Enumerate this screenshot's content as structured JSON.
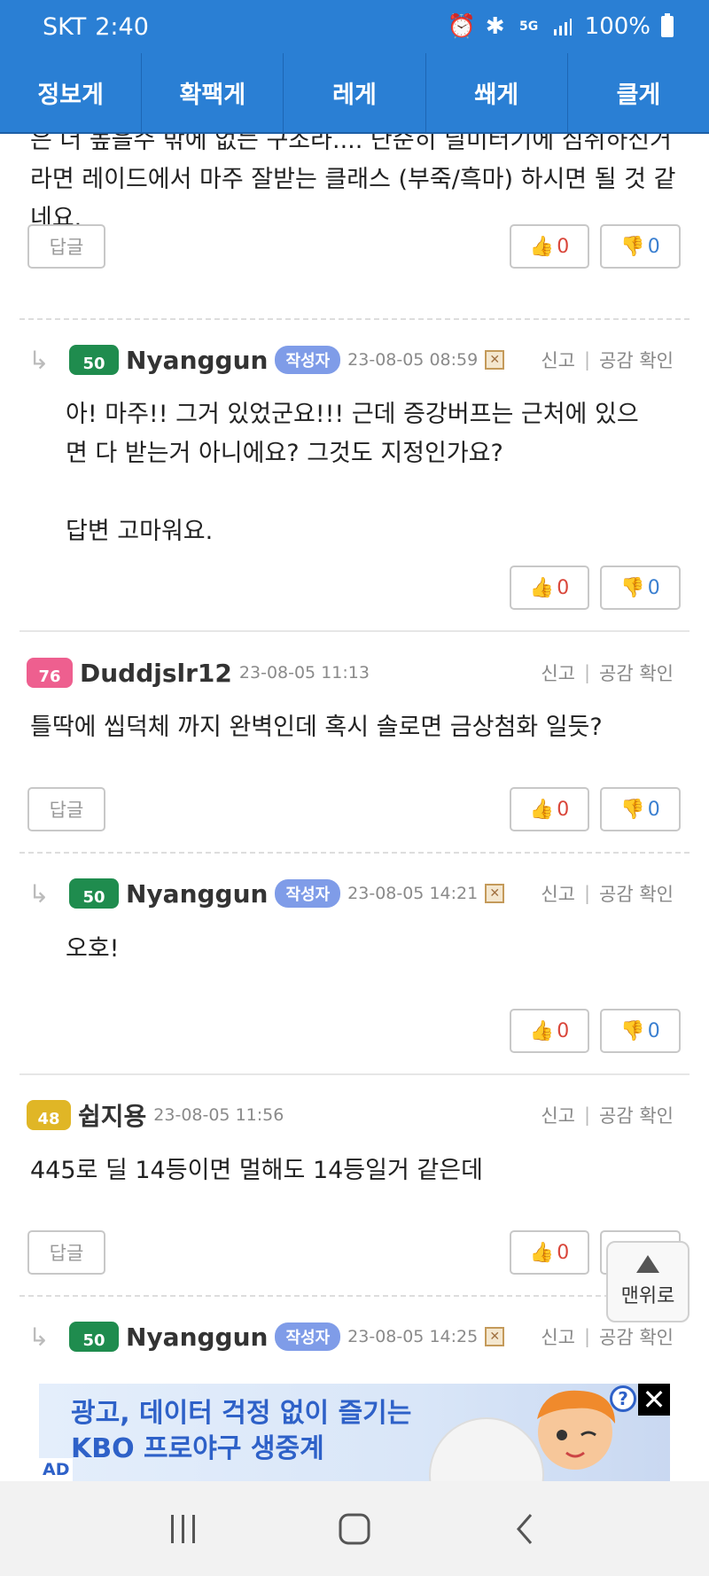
{
  "status_bar": {
    "carrier": "SKT",
    "time": "2:40",
    "battery": "100%",
    "network": "5G"
  },
  "tabs": [
    "정보게",
    "확팩게",
    "레게",
    "쐐게",
    "클게"
  ],
  "truncated_top": {
    "text": "은 더 높을수 밖에 없는 구조라.... 단순히 딜미터기에 심취하신거 라면 레이드에서 마주 잘받는 클래스 (부죽/흑마) 하시면 될 것 같네요.",
    "reply_label": "답글",
    "likes": "0",
    "dislikes": "0"
  },
  "comments": [
    {
      "type": "reply",
      "level": "50",
      "nickname": "Nyanggun",
      "author_tag": "작성자",
      "date": "23-08-05 08:59",
      "text": "아! 마주!! 그거 있었군요!!! 근데 증강버프는 근처에 있으면 다 받는거 아니에요? 그것도 지정인가요?\n\n답변 고마워요.",
      "likes": "0",
      "dislikes": "0"
    },
    {
      "type": "comment",
      "level": "76",
      "nickname": "Duddjslr12",
      "date": "23-08-05 11:13",
      "text": "틀딱에 씹덕체 까지 완벽인데 혹시 솔로면 금상첨화 일듯?",
      "reply_label": "답글",
      "likes": "0",
      "dislikes": "0"
    },
    {
      "type": "reply",
      "level": "50",
      "nickname": "Nyanggun",
      "author_tag": "작성자",
      "date": "23-08-05 14:21",
      "text": "오호!",
      "likes": "0",
      "dislikes": "0"
    },
    {
      "type": "comment",
      "level": "48",
      "nickname": "쉽지용",
      "date": "23-08-05 11:56",
      "text": "445로 딜 14등이면 멀해도 14등일거 같은데",
      "reply_label": "답글",
      "likes": "0"
    },
    {
      "type": "reply",
      "level": "50",
      "nickname": "Nyanggun",
      "author_tag": "작성자",
      "date": "23-08-05 14:25"
    }
  ],
  "actions": {
    "report": "신고",
    "sympathy": "공감 확인"
  },
  "scroll_top": {
    "label": "맨위로"
  },
  "ad": {
    "line1": "광고, 데이터 걱정 없이 즐기는",
    "line2": "KBO 프로야구 생중계",
    "label": "AD"
  },
  "icons": {
    "like": "thumbs-up-icon",
    "dislike": "thumbs-down-icon",
    "reply_arrow": "reply-arrow-icon"
  }
}
